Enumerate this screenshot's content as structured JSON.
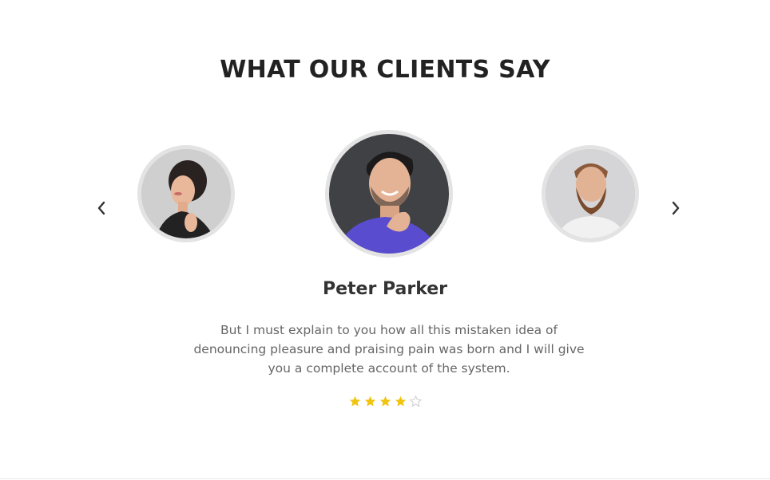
{
  "section": {
    "title": "WHAT OUR CLIENTS SAY"
  },
  "carousel": {
    "prev_icon": "chevron-left-icon",
    "next_icon": "chevron-right-icon",
    "avatars": [
      {
        "position": "left",
        "description_icon": "client-photo-woman"
      },
      {
        "position": "center",
        "description_icon": "client-photo-man-smiling"
      },
      {
        "position": "right",
        "description_icon": "client-photo-bearded-man"
      }
    ]
  },
  "testimonial": {
    "name": "Peter Parker",
    "quote": "But I must explain to you how all this mistaken idea of denouncing pleasure and praising pain was born and I will give you a complete account of the system.",
    "rating": 4,
    "rating_max": 5
  },
  "colors": {
    "star_filled": "#f1c40f",
    "star_empty": "#cccccc",
    "title": "#222222",
    "text": "#666666"
  }
}
